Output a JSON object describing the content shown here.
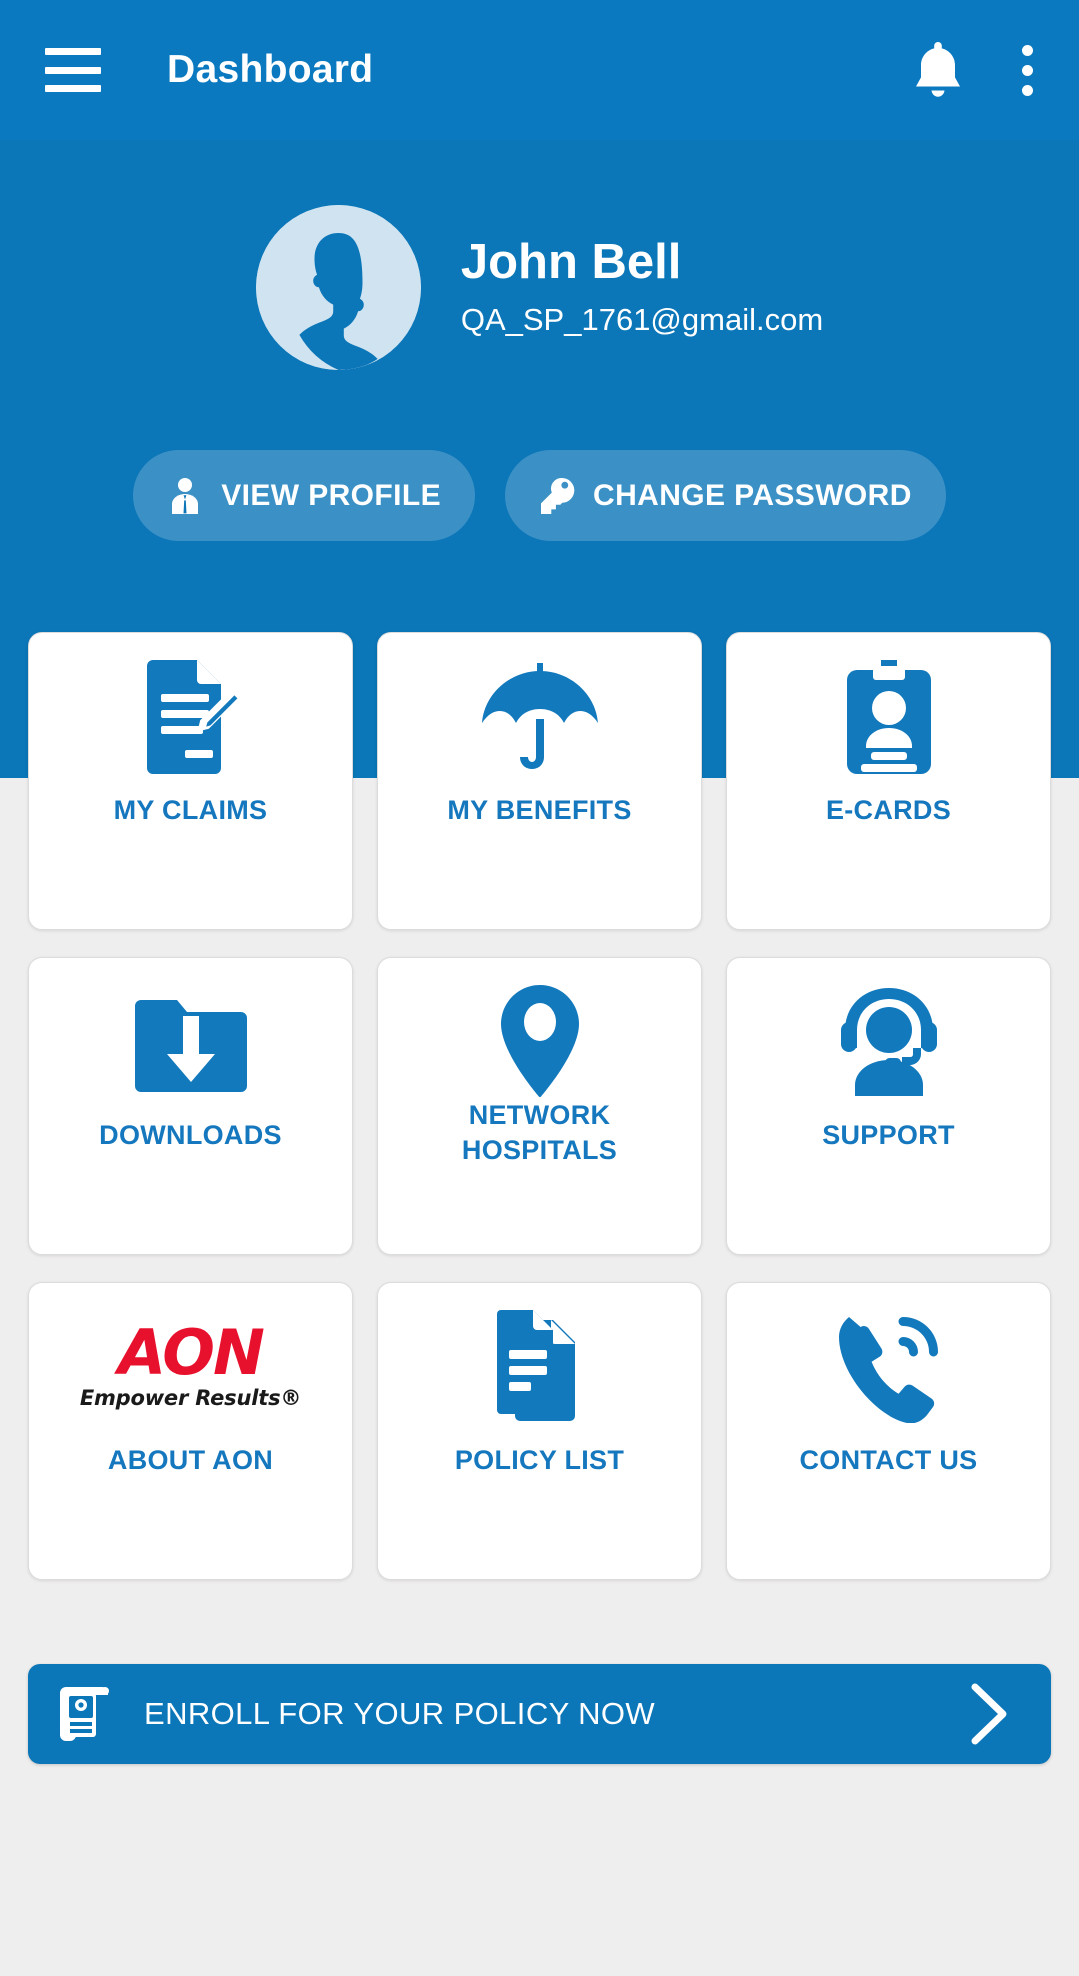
{
  "app": {
    "title": "Dashboard",
    "accent_blue": "#0b76b8",
    "appbar_blue": "#0a79c0",
    "tile_label_blue": "#1577bd",
    "page_background": "#efeeee",
    "aon_red": "#e8112d"
  },
  "appbar": {
    "menu_icon": "hamburger-menu-icon",
    "title": "Dashboard",
    "notification_icon": "bell-icon",
    "overflow_icon": "more-vertical-icon"
  },
  "profile": {
    "avatar_icon": "user-avatar-placeholder",
    "name": "John Bell",
    "email": "QA_SP_1761@gmail.com",
    "actions": [
      {
        "label": "VIEW PROFILE",
        "icon": "user-badge-icon"
      },
      {
        "label": "CHANGE PASSWORD",
        "icon": "key-icon"
      }
    ]
  },
  "tiles": [
    {
      "label": "MY CLAIMS",
      "icon": "document-edit-icon",
      "lines": 1
    },
    {
      "label": "MY BENEFITS",
      "icon": "umbrella-icon",
      "lines": 1
    },
    {
      "label": "E-CARDS",
      "icon": "id-card-icon",
      "lines": 1
    },
    {
      "label": "DOWNLOADS",
      "icon": "download-folder-icon",
      "lines": 1
    },
    {
      "label": "NETWORK\nHOSPITALS",
      "icon": "location-pin-icon",
      "lines": 2
    },
    {
      "label": "SUPPORT",
      "icon": "headset-agent-icon",
      "lines": 1
    },
    {
      "label": "ABOUT AON",
      "icon": "aon-logo",
      "lines": 1
    },
    {
      "label": "POLICY LIST",
      "icon": "document-stack-icon",
      "lines": 1
    },
    {
      "label": "CONTACT US",
      "icon": "phone-ringing-icon",
      "lines": 1
    }
  ],
  "aon_logo": {
    "wordmark": "AON",
    "tagline": "Empower Results®"
  },
  "enroll_banner": {
    "icon": "policy-scroll-icon",
    "label": "ENROLL FOR YOUR POLICY NOW",
    "chevron_icon": "chevron-right-icon"
  }
}
